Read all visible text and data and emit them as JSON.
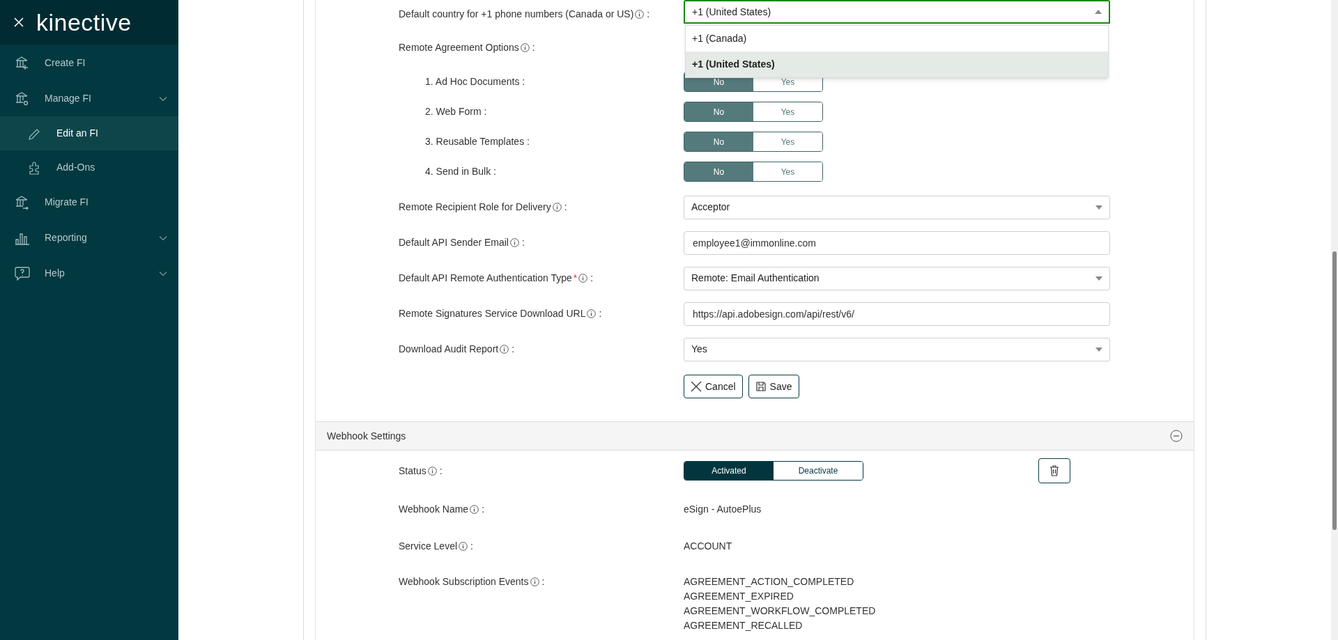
{
  "sidebar": {
    "logo": "kinective",
    "items": [
      {
        "label": "Create FI",
        "has_submenu": false,
        "selected": false
      },
      {
        "label": "Manage FI",
        "has_submenu": true,
        "selected": false,
        "children": [
          {
            "label": "Edit an FI",
            "selected": true
          },
          {
            "label": "Add-Ons",
            "selected": false
          }
        ]
      },
      {
        "label": "Migrate FI",
        "has_submenu": false,
        "selected": false
      },
      {
        "label": "Reporting",
        "has_submenu": true,
        "selected": false
      },
      {
        "label": "Help",
        "has_submenu": true,
        "selected": false
      }
    ]
  },
  "form": {
    "fields": [
      {
        "kind": "select",
        "label": "Default country for +1 phone numbers (Canada or US)",
        "info": true,
        "separator": ":",
        "value": "+1 (United States)",
        "open": true,
        "options": [
          {
            "label": "+1 (Canada)",
            "selected": false
          },
          {
            "label": "+1 (United States)",
            "selected": true
          }
        ]
      },
      {
        "kind": "heading",
        "label": "Remote Agreement Options",
        "info": true,
        "separator": ":",
        "children": [
          {
            "kind": "toggle",
            "label": "1. Ad Hoc Documents :",
            "options": [
              {
                "label": "No",
                "selected": true
              },
              {
                "label": "Yes",
                "selected": false
              }
            ]
          },
          {
            "kind": "toggle",
            "label": "2. Web Form :",
            "options": [
              {
                "label": "No",
                "selected": true
              },
              {
                "label": "Yes",
                "selected": false
              }
            ]
          },
          {
            "kind": "toggle",
            "label": "3. Reusable Templates :",
            "options": [
              {
                "label": "No",
                "selected": true
              },
              {
                "label": "Yes",
                "selected": false
              }
            ]
          },
          {
            "kind": "toggle",
            "label": "4. Send in Bulk :",
            "options": [
              {
                "label": "No",
                "selected": true
              },
              {
                "label": "Yes",
                "selected": false
              }
            ]
          }
        ]
      },
      {
        "kind": "select",
        "label": "Remote Recipient Role for Delivery",
        "info": true,
        "separator": ":",
        "value": "Acceptor",
        "open": false
      },
      {
        "kind": "input",
        "label": "Default API Sender Email",
        "info": true,
        "separator": ":",
        "value": "employee1@immonline.com"
      },
      {
        "kind": "select",
        "label": "Default API Remote Authentication Type",
        "info": true,
        "required_mark": "*",
        "separator": ":",
        "value": "Remote: Email Authentication",
        "open": false
      },
      {
        "kind": "input",
        "label": "Remote Signatures Service Download URL",
        "info": true,
        "separator": ":",
        "value": "https://api.adobesign.com/api/rest/v6/"
      },
      {
        "kind": "select",
        "label": "Download Audit Report",
        "info": true,
        "separator": ":",
        "value": "Yes",
        "open": false
      }
    ],
    "buttons": [
      {
        "kind": "cancel",
        "label": "Cancel"
      },
      {
        "kind": "save",
        "label": "Save"
      }
    ]
  },
  "webhook": {
    "title": "Webhook Settings",
    "expanded": true,
    "status": {
      "label": "Status",
      "info": true,
      "separator": ":",
      "options": [
        {
          "label": "Activated",
          "selected": true
        },
        {
          "label": "Deactivate",
          "selected": false
        }
      ]
    },
    "fields": [
      {
        "label": "Webhook Name",
        "info": true,
        "separator": ":",
        "values": [
          "eSign - AutoePlus"
        ]
      },
      {
        "label": "Service Level",
        "info": true,
        "separator": ":",
        "values": [
          "ACCOUNT"
        ]
      },
      {
        "label": "Webhook Subscription Events",
        "info": true,
        "separator": ":",
        "values": [
          "AGREEMENT_ACTION_COMPLETED",
          "AGREEMENT_EXPIRED",
          "AGREEMENT_WORKFLOW_COMPLETED",
          "AGREEMENT_RECALLED"
        ]
      }
    ]
  }
}
